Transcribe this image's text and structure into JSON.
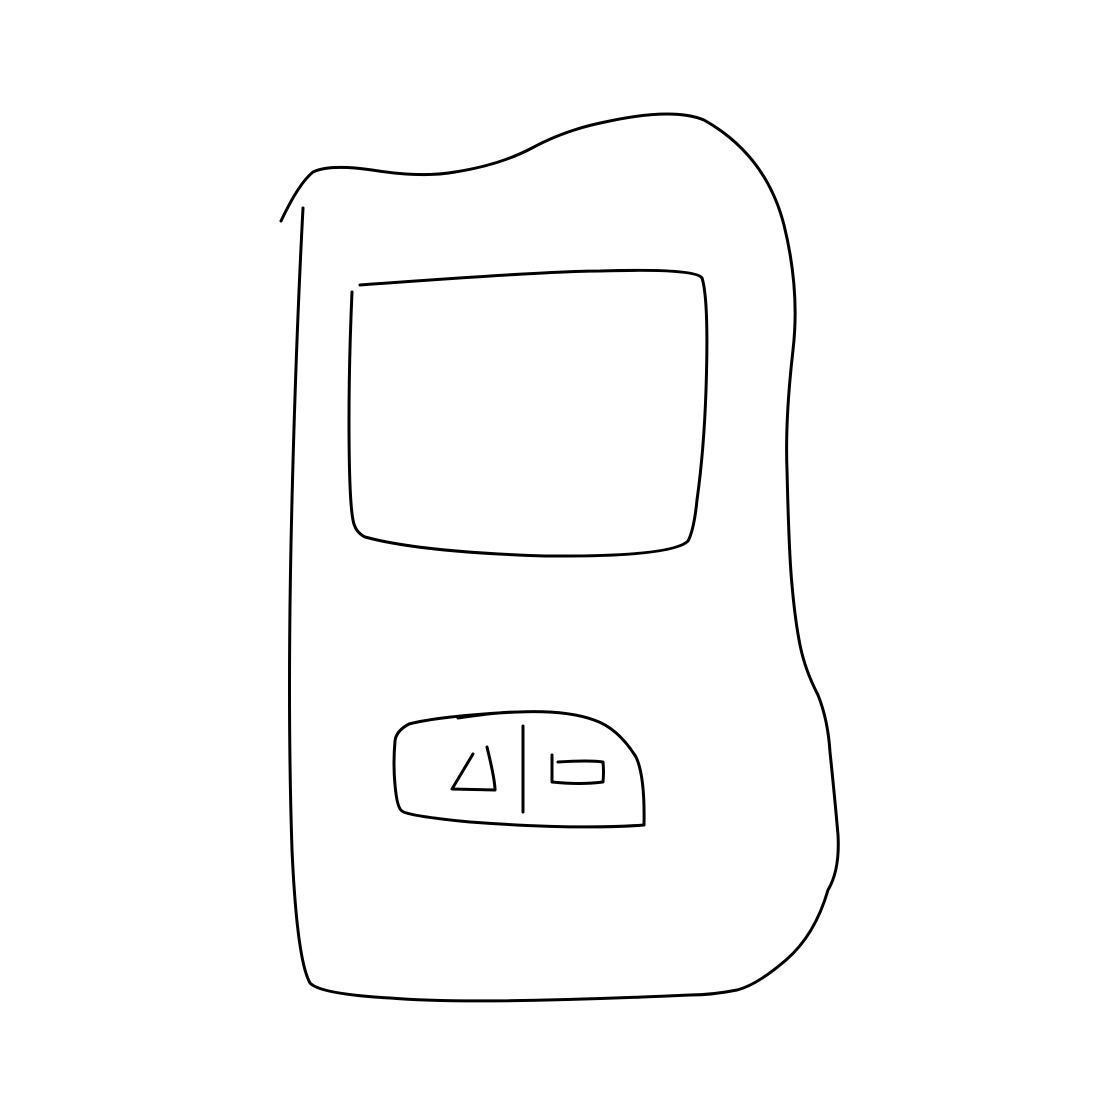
{
  "drawing": {
    "background_color": "#ffffff",
    "stroke_color": "#000000",
    "subject": "handheld-device-sketch",
    "button_icons": [
      "triangle-icon",
      "divider-line",
      "rectangle-icon"
    ]
  }
}
